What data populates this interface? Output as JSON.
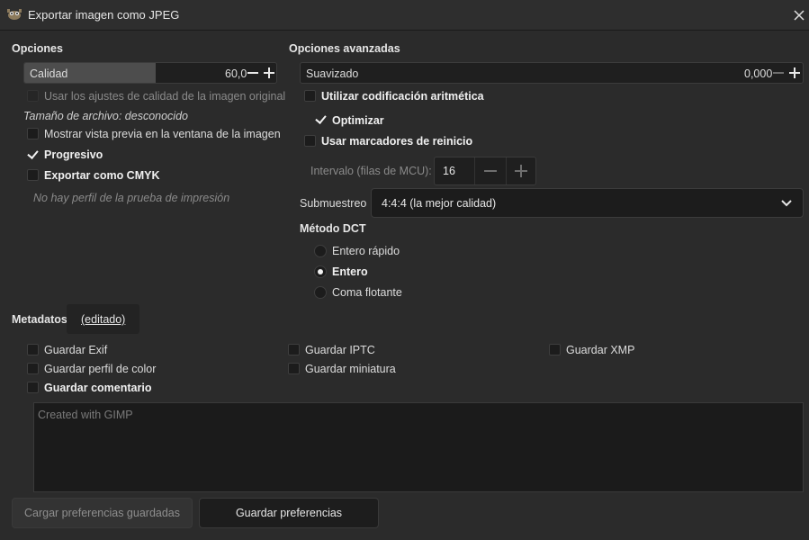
{
  "window": {
    "title": "Exportar imagen como JPEG",
    "icon": "gimp-icon"
  },
  "options": {
    "heading": "Opciones",
    "quality": {
      "label": "Calidad",
      "value": "60,0",
      "fraction": 0.6
    },
    "use_original_quality": {
      "label": "Usar los ajustes de calidad de la imagen original",
      "checked": false,
      "enabled": false
    },
    "file_size": "Tamaño de archivo: desconocido",
    "show_preview": {
      "label": "Mostrar vista previa en la ventana de la imagen",
      "checked": false
    },
    "progressive": {
      "label": "Progresivo",
      "checked": true
    },
    "export_cmyk": {
      "label": "Exportar como CMYK",
      "checked": false
    },
    "no_profile": "No hay perfil de la prueba de impresión"
  },
  "advanced": {
    "heading": "Opciones avanzadas",
    "smoothing": {
      "label": "Suavizado",
      "value": "0,000"
    },
    "arithmetic": {
      "label": "Utilizar codificación aritmética",
      "checked": false
    },
    "optimize": {
      "label": "Optimizar",
      "checked": true
    },
    "restart_markers": {
      "label": "Usar marcadores de reinicio",
      "checked": false
    },
    "interval": {
      "label": "Intervalo (filas de MCU):",
      "value": "16"
    },
    "subsampling": {
      "label": "Submuestreo",
      "value": "4:4:4 (la mejor calidad)"
    },
    "dct": {
      "heading": "Método DCT",
      "options": [
        {
          "label": "Entero rápido",
          "selected": false
        },
        {
          "label": "Entero",
          "selected": true
        },
        {
          "label": "Coma flotante",
          "selected": false
        }
      ]
    }
  },
  "metadata": {
    "heading": "Metadatos",
    "tab": "(editado)",
    "save_exif": {
      "label": "Guardar Exif",
      "checked": false
    },
    "save_iptc": {
      "label": "Guardar IPTC",
      "checked": false
    },
    "save_xmp": {
      "label": "Guardar XMP",
      "checked": false
    },
    "save_color_profile": {
      "label": "Guardar perfil de color",
      "checked": false
    },
    "save_thumbnail": {
      "label": "Guardar miniatura",
      "checked": false
    },
    "save_comment": {
      "label": "Guardar comentario",
      "checked": false
    },
    "comment_text": "Created with GIMP"
  },
  "buttons": {
    "load_prefs": "Cargar preferencias guardadas",
    "save_prefs": "Guardar preferencias"
  },
  "colors": {
    "background": "#2b2b2b",
    "field": "#1f1f1f",
    "accent_fill": "#4d4d4d"
  }
}
